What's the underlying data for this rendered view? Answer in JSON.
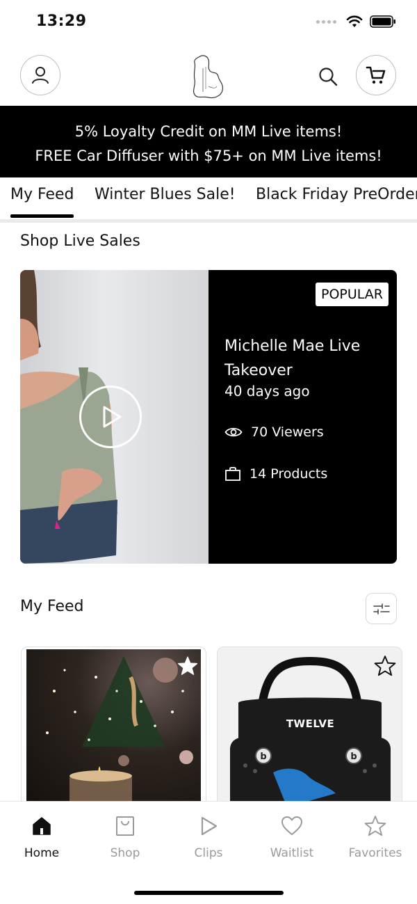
{
  "status_bar": {
    "time": "13:29"
  },
  "header": {
    "account_icon": "person-icon",
    "logo_icon": "michigan-logo-icon",
    "search_icon": "search-icon",
    "cart_icon": "cart-icon"
  },
  "banner": {
    "line1": "5% Loyalty Credit on MM Live items!",
    "line2": "FREE Car Diffuser with $75+ on MM Live items!"
  },
  "tabs": [
    {
      "label": "My Feed",
      "active": true
    },
    {
      "label": "Winter Blues Sale!",
      "active": false
    },
    {
      "label": "Black Friday PreOrder",
      "active": false
    }
  ],
  "live_section": {
    "title": "Shop Live Sales",
    "card": {
      "badge": "POPULAR",
      "title": "Michelle Mae Live Takeover",
      "time_ago": "40 days ago",
      "viewers": "70 Viewers",
      "products": "14 Products"
    }
  },
  "feed_section": {
    "title": "My Feed",
    "products": [
      {
        "image": "christmas-tree-candle-photo",
        "favorited": true
      },
      {
        "image": "black-tote-bag-photo",
        "bag_text": "TWELVE",
        "favorited": false
      }
    ]
  },
  "bottom_nav": {
    "items": [
      {
        "label": "Home",
        "icon": "home-icon",
        "active": true
      },
      {
        "label": "Shop",
        "icon": "shopping-bag-icon",
        "active": false
      },
      {
        "label": "Clips",
        "icon": "play-icon",
        "active": false
      },
      {
        "label": "Waitlist",
        "icon": "heart-icon",
        "active": false
      },
      {
        "label": "Favorites",
        "icon": "star-icon",
        "active": false
      }
    ]
  }
}
